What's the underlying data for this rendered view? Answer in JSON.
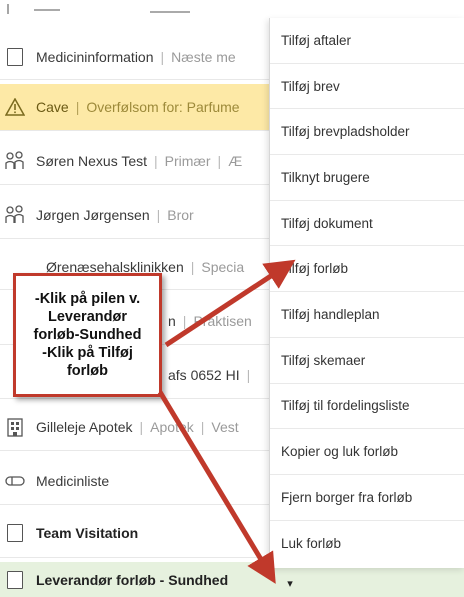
{
  "rows": [
    {
      "key": "medicin",
      "icon": "document-icon",
      "primary": "Medicininformation",
      "secondary": "Næste me"
    },
    {
      "key": "cave",
      "icon": "warning-icon",
      "primary": "Cave",
      "secondary": "Overfølsom for: Parfume"
    },
    {
      "key": "soren",
      "icon": "relation-icon",
      "primary": "Søren Nexus Test",
      "secondary": "Primær",
      "tertiary": "Æ"
    },
    {
      "key": "jorgen",
      "icon": "relation-icon",
      "primary": "Jørgen Jørgensen",
      "secondary": "Bror"
    },
    {
      "key": "oere",
      "icon": "",
      "primary": "Ørenæsehalsklinikken",
      "secondary": "Specia"
    },
    {
      "key": "praktiserende",
      "icon": "",
      "primary": "n",
      "secondary": "Praktisen"
    },
    {
      "key": "hjaelpemiddel",
      "icon": "",
      "primary": "afs 0652 HI",
      "secondary": ""
    },
    {
      "key": "apotek",
      "icon": "building-icon",
      "primary": "Gilleleje Apotek",
      "secondary": "Apotek",
      "tertiary": "Vest"
    },
    {
      "key": "medicinliste",
      "icon": "pill-icon",
      "primary": "Medicinliste"
    },
    {
      "key": "team",
      "icon": "document-icon",
      "primary": "Team Visitation"
    },
    {
      "key": "leverandor",
      "icon": "document-icon",
      "primary": "Leverandør forløb - Sundhed"
    }
  ],
  "menu": {
    "items": [
      "Tilføj aftaler",
      "Tilføj brev",
      "Tilføj brevpladsholder",
      "Tilknyt brugere",
      "Tilføj dokument",
      "Tilføj forløb",
      "Tilføj handleplan",
      "Tilføj skemaer",
      "Tilføj til fordelingsliste",
      "Kopier og luk forløb",
      "Fjern borger fra forløb",
      "Luk forløb"
    ]
  },
  "dropdown_arrow": "▾",
  "callout": {
    "lines": [
      "-Klik på pilen v.",
      "Leverandør",
      "forløb-Sundhed",
      "-Klik på Tilføj",
      "forløb"
    ]
  },
  "colors": {
    "cave_bg": "#fde9a6",
    "selected_bg": "#e6f1de",
    "annotation_red": "#c0392b"
  }
}
